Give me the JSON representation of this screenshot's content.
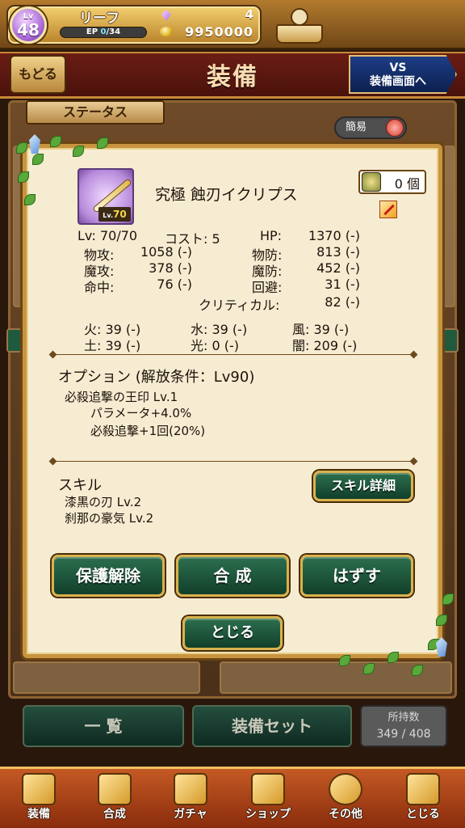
{
  "player": {
    "level_label": "Lv",
    "level": "48",
    "name": "リーフ",
    "ep_label": "EP",
    "ep_current": "0",
    "ep_max": "/34",
    "gems": "4",
    "gold": "9950000"
  },
  "header": {
    "back_label": "もどる",
    "title": "装備",
    "vs_line1": "VS",
    "vs_line2": "装備画面へ"
  },
  "status_tab": "ステータス",
  "simple_toggle": "簡易",
  "item": {
    "name": "究極 蝕刃イクリプス",
    "lv_badge_prefix": "Lv.",
    "lv_badge": "70",
    "owned": "0 個",
    "stats": {
      "lv": "Lv: 70/70",
      "cost": "コスト: 5",
      "hp_label": "HP:",
      "hp_value": "1370 (-)",
      "atk_label": "物攻:",
      "atk_value": "1058 (-)",
      "def_label": "物防:",
      "def_value": "813 (-)",
      "matk_label": "魔攻:",
      "matk_value": "378 (-)",
      "mdef_label": "魔防:",
      "mdef_value": "452 (-)",
      "hit_label": "命中:",
      "hit_value": "76 (-)",
      "eva_label": "回避:",
      "eva_value": "31 (-)",
      "crit_label": "クリティカル:",
      "crit_value": "82 (-)"
    },
    "elements": {
      "fire": "火: 39 (-)",
      "water": "水: 39 (-)",
      "wind": "風: 39 (-)",
      "earth": "土: 39 (-)",
      "light": "光: 0 (-)",
      "dark": "闇: 209 (-)"
    },
    "option": {
      "title": "オプション (解放条件：Lv90)",
      "name": "必殺追撃の王印 Lv.1",
      "line1": "パラメータ+4.0%",
      "line2": "必殺追撃+1回(20%)"
    },
    "skill": {
      "title": "スキル",
      "items": [
        "漆黒の刃 Lv.2",
        "刹那の豪気 Lv.2"
      ],
      "detail_button": "スキル詳細"
    }
  },
  "buttons": {
    "unprotect": "保護解除",
    "synthesize": "合 成",
    "remove": "はずす",
    "close": "とじる"
  },
  "bottom": {
    "list": "一 覧",
    "equip_set": "装備セット",
    "holding_label": "所持数",
    "holding_value": "349 / 408"
  },
  "nav": [
    {
      "label": "装備",
      "icon": "equipment-icon"
    },
    {
      "label": "合成",
      "icon": "hammer-icon"
    },
    {
      "label": "ガチャ",
      "icon": "gacha-icon"
    },
    {
      "label": "ショップ",
      "icon": "shop-icon"
    },
    {
      "label": "その他",
      "icon": "gear-icon"
    },
    {
      "label": "とじる",
      "icon": "close-icon"
    }
  ],
  "colors": {
    "button_green": "#1f5a3e",
    "button_border": "#d8b24d",
    "header_red": "#5a1810",
    "modal_bg": "#f6ecd2"
  }
}
